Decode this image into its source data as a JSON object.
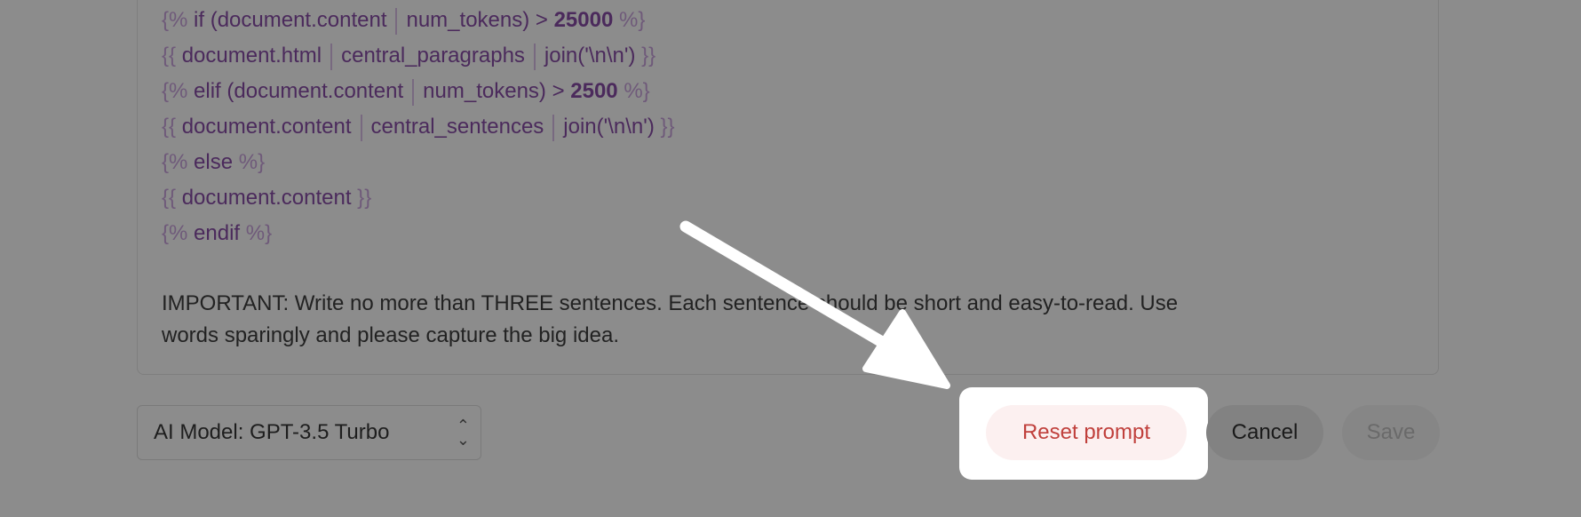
{
  "prompt_editor": {
    "code_lines": [
      {
        "open": "{%",
        "parts": [
          "if (document.content",
          "num_tokens) > "
        ],
        "num": "25000",
        "close": "%}"
      },
      {
        "open": "{{",
        "parts": [
          "document.html",
          "central_paragraphs",
          "join('\\n\\n')"
        ],
        "num": "",
        "close": "}}"
      },
      {
        "open": "{%",
        "parts": [
          "elif (document.content",
          "num_tokens) > "
        ],
        "num": "2500",
        "close": "%}"
      },
      {
        "open": "{{",
        "parts": [
          "document.content",
          "central_sentences",
          "join('\\n\\n')"
        ],
        "num": "",
        "close": "}}"
      },
      {
        "open": "{%",
        "parts": [
          "else"
        ],
        "num": "",
        "close": "%}"
      },
      {
        "open": "{{",
        "parts": [
          "document.content"
        ],
        "num": "",
        "close": "}}"
      },
      {
        "open": "{%",
        "parts": [
          "endif"
        ],
        "num": "",
        "close": "%}"
      }
    ],
    "instruction_line_1": "IMPORTANT: Write no more than THREE sentences. Each sentence should be short and easy-to-read. Use",
    "instruction_line_2": "words sparingly and please capture the big idea."
  },
  "footer": {
    "model_select": "AI Model: GPT-3.5 Turbo",
    "reset_label": "Reset prompt",
    "cancel_label": "Cancel",
    "save_label": "Save"
  },
  "colors": {
    "overlay": "#8c8c8c",
    "reset_text": "#c0403c",
    "code_text": "#4b2a5c"
  }
}
